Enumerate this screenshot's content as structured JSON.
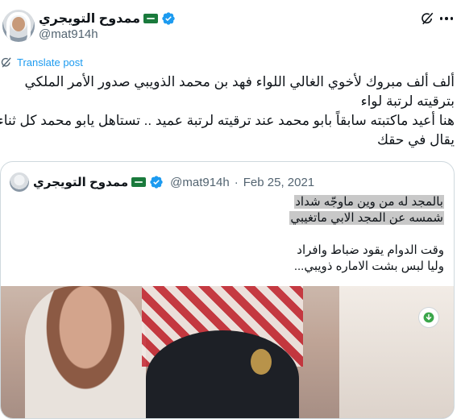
{
  "author": {
    "name": "ممدوح التويجري",
    "handle": "@mat914h"
  },
  "actions": {
    "translate_label": "Translate post"
  },
  "tweet": {
    "lines": [
      "ألف ألف مبروك لأخوي الغالي اللواء فهد بن محمد الذويبي صدور الأمر الملكي",
      "بترقيته لرتبة لواء",
      "هنا أعيد ماكتبته سابقاً بابو محمد عند ترقيته لرتبة عميد .. تستاهل يابو محمد كل ثناء",
      "يقال في حقك"
    ]
  },
  "quote": {
    "name": "ممدوح التويجري",
    "handle": "@mat914h",
    "separator": "·",
    "date": "Feb 25, 2021",
    "lines": [
      "بالمجد له من وين ماوجّه شداد",
      "شمسه عن المجد الابي ماتغيبي",
      "",
      "وقت الدوام يقود ضباط وافراد",
      "وليا لبس  بشت  الاماره  ذويبي..."
    ]
  },
  "colors": {
    "accent": "#1d9bf0",
    "text": "#0f1419",
    "muted": "#536471",
    "border": "#cfd9de",
    "flag_green": "#1a7a3c"
  },
  "icons": [
    "avatar",
    "saudi-flag-icon",
    "verified-badge-icon",
    "grok-icon",
    "more-icon",
    "translate-icon",
    "download-icon"
  ]
}
